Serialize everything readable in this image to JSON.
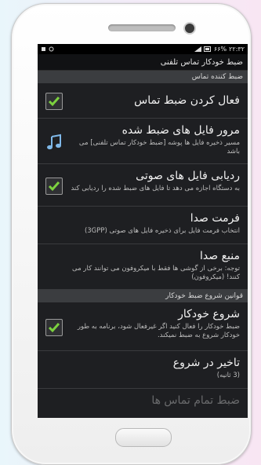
{
  "status": {
    "time": "۲۲:۳۲",
    "battery": "۶۶%"
  },
  "title": "ضبط خودکار تماس تلفنی",
  "section1": {
    "header": "ضبط کننده تماس"
  },
  "items1": [
    {
      "title": "فعال کردن ضبط تماس",
      "summary": ""
    },
    {
      "title": "مرور فایل های ضبط شده",
      "summary": "مسیر ذخیره فایل ها پوشه [ضبط خودکار تماس تلفنی] می باشد"
    },
    {
      "title": "ردیابی فایل های صوتی",
      "summary": "به دستگاه اجازه می دهد تا فایل های ضبط شده را ردیابی کند"
    },
    {
      "title": "فرمت صدا",
      "summary": "انتخاب فرمت فایل برای ذخیره فایل های صوتی (3GPP)"
    },
    {
      "title": "منبع صدا",
      "summary": "توجه: برخی از گوشی ها فقط با میکروفون می توانند کار می کنند! (میکروفون)"
    }
  ],
  "section2": {
    "header": "قوانین شروع ضبط خودکار"
  },
  "items2": [
    {
      "title": "شروع خودکار",
      "summary": "ضبط خودکار را فعال کنید اگر غیرفعال شود، برنامه به طور خودکار شروع به ضبط نمیکند."
    },
    {
      "title": "تاخیر در شروع",
      "summary": "(3 ثانیه)"
    },
    {
      "title": "ضبط تمام تماس ها",
      "summary": ""
    }
  ],
  "colors": {
    "accent": "#7cd13f",
    "screen_bg": "#1e1f22",
    "section_bg": "#3b3d40"
  }
}
